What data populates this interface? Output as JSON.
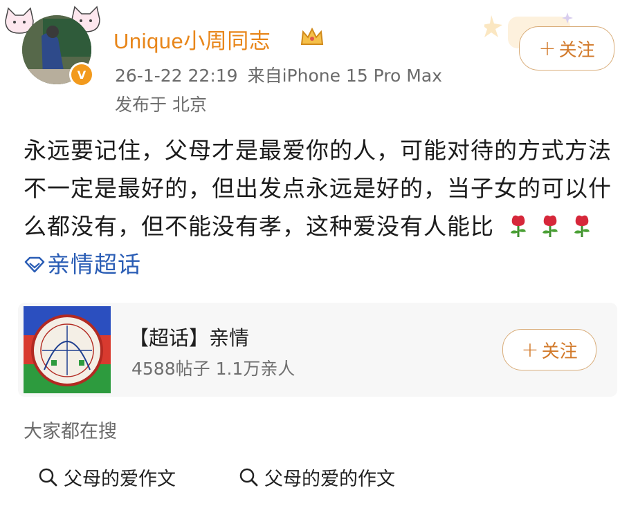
{
  "post": {
    "username": "Unique小周同志",
    "time": "26-1-22 22:19",
    "source": "来自iPhone 15 Pro Max",
    "location": "发布于 北京",
    "follow_label": "关注",
    "body_text": "永远要记住，父母才是最爱你的人，可能对待的方式方法不一定是最好的，但出发点永远是好的，当子女的可以什么都没有，但不能没有孝，这种爱没有人能比",
    "topic_link": "亲情超话"
  },
  "topic_card": {
    "title": "【超话】亲情",
    "stats": "4588帖子 1.1万亲人",
    "follow_label": "关注"
  },
  "search": {
    "heading": "大家都在搜",
    "items": [
      "父母的爱作文",
      "父母的爱的作文"
    ]
  },
  "icons": {
    "verified": "verified-v-icon",
    "crown": "crown-icon",
    "rose": "rose-emoji-icon",
    "diamond": "diamond-topic-icon",
    "search": "search-icon"
  },
  "colors": {
    "username": "#e8861a",
    "follow_border": "#d9ad7a",
    "follow_text": "#d27a2b",
    "link": "#2a5db5",
    "meta": "#6b6b6b"
  }
}
